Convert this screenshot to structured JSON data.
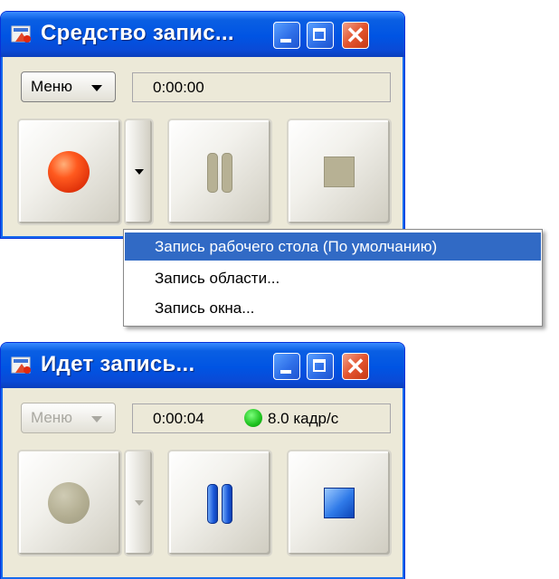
{
  "window_idle": {
    "title": "Средство запис...",
    "menu_label": "Меню",
    "timer": "0:00:00"
  },
  "dropdown_menu": {
    "items": [
      {
        "label": "Запись рабочего стола (По умолчанию)",
        "selected": true
      },
      {
        "label": "Запись области...",
        "selected": false
      },
      {
        "label": "Запись окна...",
        "selected": false
      }
    ]
  },
  "window_recording": {
    "title": "Идет запись...",
    "menu_label": "Меню",
    "timer": "0:00:04",
    "fps": "8.0 кадр/с",
    "fps_indicator_color": "#1ec21e"
  },
  "colors": {
    "titlebar": "#0054e3",
    "record_button": "#ff5a1f",
    "selection": "#316ac5",
    "close_button": "#e3542e"
  },
  "icons": {
    "app": "recorder-app-icon",
    "minimize": "minimize-icon",
    "maximize": "maximize-icon",
    "close": "close-icon",
    "record": "record-icon",
    "pause": "pause-icon",
    "stop": "stop-icon"
  }
}
